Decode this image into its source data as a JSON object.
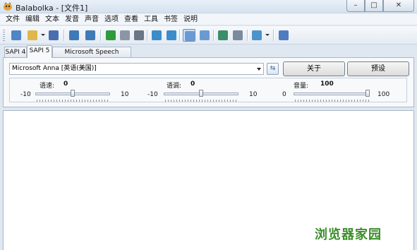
{
  "window": {
    "title": "Balabolka - [文件1]"
  },
  "controls": {
    "minimize": "–",
    "maximize": "□",
    "close": "✕"
  },
  "menu": [
    "文件",
    "编辑",
    "文本",
    "发音",
    "声音",
    "选项",
    "查看",
    "工具",
    "书签",
    "说明"
  ],
  "toolbar": {
    "buttons": [
      {
        "name": "new-document-icon",
        "color": "#4f86c6"
      },
      {
        "name": "open-folder-icon",
        "color": "#e0b84a"
      },
      {
        "name": "save-icon",
        "color": "#4a6fb0"
      },
      {
        "name": "read-aloud-icon",
        "color": "#3f7ab8"
      },
      {
        "name": "read-clipboard-icon",
        "color": "#3f7ab8"
      },
      {
        "name": "play-icon",
        "color": "#2e9a3c"
      },
      {
        "name": "pause-icon",
        "color": "#8a96a6"
      },
      {
        "name": "stop-icon",
        "color": "#6b7686"
      },
      {
        "name": "save-audio-icon",
        "color": "#3b8cc9"
      },
      {
        "name": "split-audio-icon",
        "color": "#3b8cc9"
      },
      {
        "name": "view-text-icon",
        "color": "#6a9ad2"
      },
      {
        "name": "view-panel-icon",
        "color": "#6a9ad2"
      },
      {
        "name": "dictionary-icon",
        "color": "#3a8f6a"
      },
      {
        "name": "convert-icon",
        "color": "#7b8b9e"
      },
      {
        "name": "voice-menu-icon",
        "color": "#4b93c9"
      },
      {
        "name": "help-icon",
        "color": "#4f7cc0"
      }
    ]
  },
  "tabs": [
    {
      "label": "SAPI 4",
      "active": false
    },
    {
      "label": "SAPI 5",
      "active": true
    },
    {
      "label": "Microsoft Speech Platform",
      "active": false
    }
  ],
  "voice": {
    "selected": "Microsoft Anna [英语(美国)]"
  },
  "buttons": {
    "about": "关于",
    "preset": "预设",
    "swap": "⇆"
  },
  "sliders": [
    {
      "label": "语速:",
      "value": "0",
      "min": "-10",
      "max": "10",
      "level": 0.5
    },
    {
      "label": "语调:",
      "value": "0",
      "min": "-10",
      "max": "10",
      "level": 0.5
    },
    {
      "label": "音量:",
      "value": "100",
      "min": "0",
      "max": "100",
      "level": 1.0
    }
  ],
  "watermark": "浏览器家园"
}
